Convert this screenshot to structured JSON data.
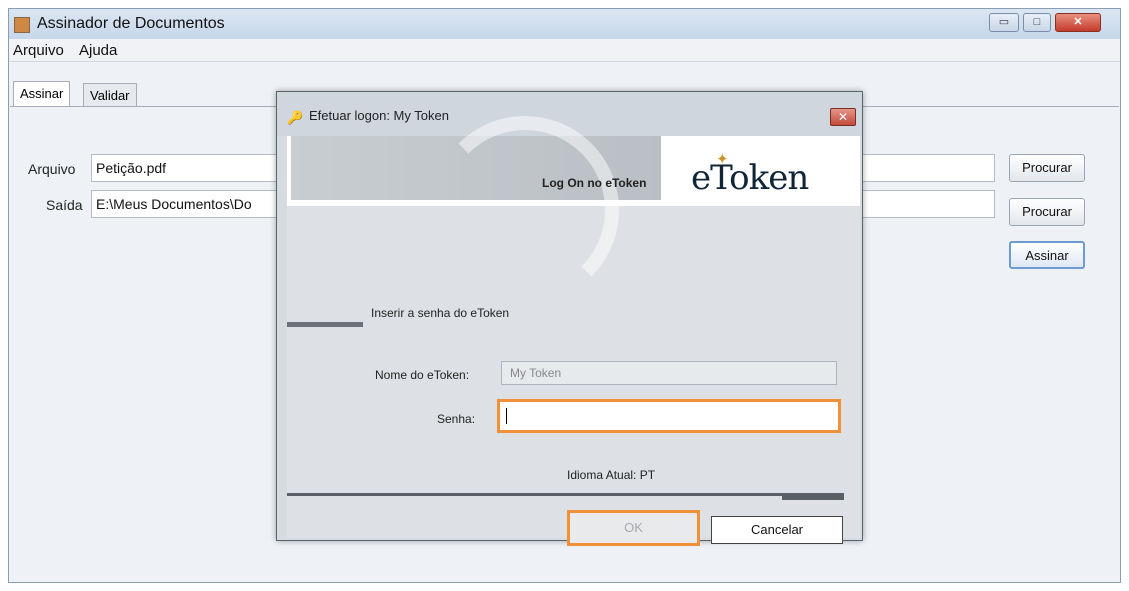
{
  "window": {
    "title": "Assinador de Documentos",
    "controls": {
      "minimize": "▭",
      "maximize": "□",
      "close": "✕"
    }
  },
  "menu": [
    {
      "label": "Arquivo"
    },
    {
      "label": "Ajuda"
    }
  ],
  "tabs": [
    {
      "label": "Assinar",
      "active": true
    },
    {
      "label": "Validar",
      "active": false
    }
  ],
  "form": {
    "arquivo_label": "Arquivo",
    "arquivo_value": "Petição.pdf",
    "saida_label": "Saída",
    "saida_value": "E:\\Meus Documentos\\Do",
    "procurar_label": "Procurar",
    "assinar_label": "Assinar"
  },
  "dialog": {
    "title": "Efetuar logon: My Token",
    "header_text": "Log On no eToken",
    "logo_text": "eToken",
    "prompt": "Inserir a senha do eToken",
    "token_name_label": "Nome do eToken:",
    "token_name_value": "My Token",
    "password_label": "Senha:",
    "password_value": "",
    "language": "Idioma Atual: PT",
    "ok_label": "OK",
    "cancel_label": "Cancelar",
    "highlight_color": "#f0913a"
  }
}
